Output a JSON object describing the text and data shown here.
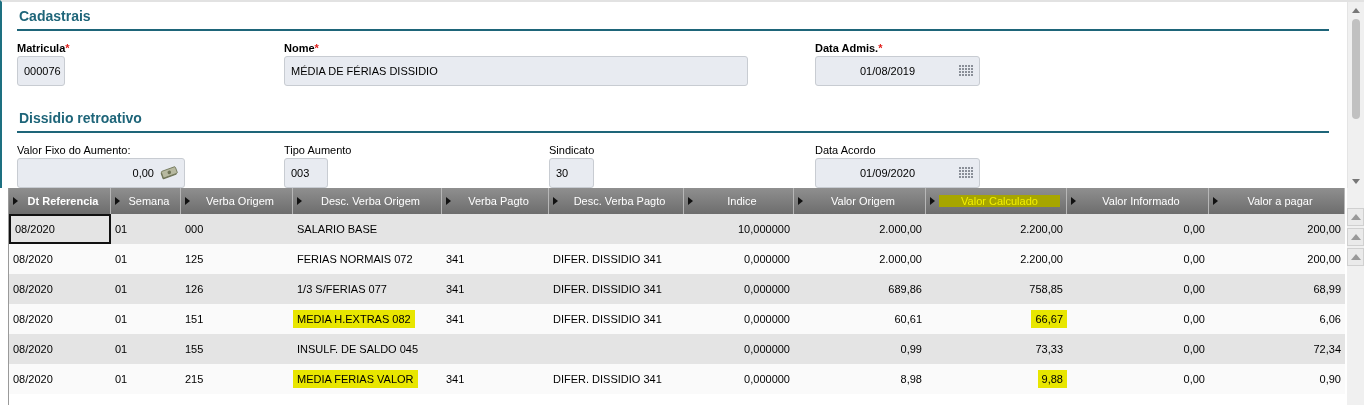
{
  "sections": [
    {
      "title": "Cadastrais",
      "kind": "bold-labels",
      "fields": [
        {
          "label": "Matricula",
          "required_mark": "*",
          "value": "000076",
          "kind": "text"
        },
        {
          "label": "Nome",
          "required_mark": "*",
          "value": "MÉDIA DE FÉRIAS DISSIDIO",
          "kind": "text"
        },
        {
          "label": "Data Admis.",
          "required_mark": "*",
          "value": "01/08/2019",
          "kind": "date"
        }
      ]
    },
    {
      "title": "Dissidio retroativo",
      "kind": "plain-labels",
      "fields": [
        {
          "label": "Valor Fixo do Aumento:",
          "value": "0,00",
          "kind": "money"
        },
        {
          "label": "Tipo Aumento",
          "value": "003",
          "kind": "text"
        },
        {
          "label": "Sindicato",
          "value": "30",
          "kind": "text"
        },
        {
          "label": "Data Acordo",
          "value": "01/09/2020",
          "kind": "date"
        }
      ]
    }
  ],
  "grid": {
    "columns": [
      {
        "label": "Dt Referencia",
        "highlighted": false
      },
      {
        "label": "Semana",
        "highlighted": false
      },
      {
        "label": "Verba Origem",
        "highlighted": false
      },
      {
        "label": "Desc. Verba Origem",
        "highlighted": false
      },
      {
        "label": "Verba Pagto",
        "highlighted": false
      },
      {
        "label": "Desc. Verba Pagto",
        "highlighted": false
      },
      {
        "label": "Indice",
        "highlighted": false
      },
      {
        "label": "Valor Origem",
        "highlighted": false
      },
      {
        "label": "Valor Calculado",
        "highlighted": true
      },
      {
        "label": "Valor Informado",
        "highlighted": false
      },
      {
        "label": "Valor a pagar",
        "highlighted": false
      }
    ],
    "rows": [
      {
        "focused": true,
        "cells": [
          {
            "text": "08/2020",
            "highlighted": false
          },
          {
            "text": "01",
            "highlighted": false
          },
          {
            "text": "000",
            "highlighted": false
          },
          {
            "text": "SALARIO BASE",
            "highlighted": false
          },
          {
            "highlighted": false
          },
          {
            "highlighted": false
          },
          {
            "text": "10,000000",
            "highlighted": false
          },
          {
            "text": "2.000,00",
            "highlighted": false
          },
          {
            "text": "2.200,00",
            "highlighted": false
          },
          {
            "text": "0,00",
            "highlighted": false
          },
          {
            "text": "200,00",
            "highlighted": false
          }
        ]
      },
      {
        "focused": false,
        "cells": [
          {
            "text": "08/2020",
            "highlighted": false
          },
          {
            "text": "01",
            "highlighted": false
          },
          {
            "text": "125",
            "highlighted": false
          },
          {
            "text": "FERIAS NORMAIS 072",
            "highlighted": false
          },
          {
            "text": "341",
            "highlighted": false
          },
          {
            "text": "DIFER. DISSIDIO 341",
            "highlighted": false
          },
          {
            "text": "0,000000",
            "highlighted": false
          },
          {
            "text": "2.000,00",
            "highlighted": false
          },
          {
            "text": "2.200,00",
            "highlighted": false
          },
          {
            "text": "0,00",
            "highlighted": false
          },
          {
            "text": "200,00",
            "highlighted": false
          }
        ]
      },
      {
        "focused": false,
        "cells": [
          {
            "text": "08/2020",
            "highlighted": false
          },
          {
            "text": "01",
            "highlighted": false
          },
          {
            "text": "126",
            "highlighted": false
          },
          {
            "text": "1/3 S/FERIAS 077",
            "highlighted": false
          },
          {
            "text": "341",
            "highlighted": false
          },
          {
            "text": "DIFER. DISSIDIO 341",
            "highlighted": false
          },
          {
            "text": "0,000000",
            "highlighted": false
          },
          {
            "text": "689,86",
            "highlighted": false
          },
          {
            "text": "758,85",
            "highlighted": false
          },
          {
            "text": "0,00",
            "highlighted": false
          },
          {
            "text": "68,99",
            "highlighted": false
          }
        ]
      },
      {
        "focused": false,
        "cells": [
          {
            "text": "08/2020",
            "highlighted": false
          },
          {
            "text": "01",
            "highlighted": false
          },
          {
            "text": "151",
            "highlighted": false
          },
          {
            "text": "MEDIA H.EXTRAS 082",
            "highlighted": true
          },
          {
            "text": "341",
            "highlighted": false
          },
          {
            "text": "DIFER. DISSIDIO 341",
            "highlighted": false
          },
          {
            "text": "0,000000",
            "highlighted": false
          },
          {
            "text": "60,61",
            "highlighted": false
          },
          {
            "text": "66,67",
            "highlighted": true
          },
          {
            "text": "0,00",
            "highlighted": false
          },
          {
            "text": "6,06",
            "highlighted": false
          }
        ]
      },
      {
        "focused": false,
        "cells": [
          {
            "text": "08/2020",
            "highlighted": false
          },
          {
            "text": "01",
            "highlighted": false
          },
          {
            "text": "155",
            "highlighted": false
          },
          {
            "text": "INSULF. DE SALDO 045",
            "highlighted": false
          },
          {
            "highlighted": false
          },
          {
            "highlighted": false
          },
          {
            "text": "0,000000",
            "highlighted": false
          },
          {
            "text": "0,99",
            "highlighted": false
          },
          {
            "text": "73,33",
            "highlighted": false
          },
          {
            "text": "0,00",
            "highlighted": false
          },
          {
            "text": "72,34",
            "highlighted": false
          }
        ]
      },
      {
        "focused": false,
        "cells": [
          {
            "text": "08/2020",
            "highlighted": false
          },
          {
            "text": "01",
            "highlighted": false
          },
          {
            "text": "215",
            "highlighted": false
          },
          {
            "text": "MEDIA FERIAS VALOR",
            "highlighted": true
          },
          {
            "text": "341",
            "highlighted": false
          },
          {
            "text": "DIFER. DISSIDIO 341",
            "highlighted": false
          },
          {
            "text": "0,000000",
            "highlighted": false
          },
          {
            "text": "8,98",
            "highlighted": false
          },
          {
            "text": "9,88",
            "highlighted": true
          },
          {
            "text": "0,00",
            "highlighted": false
          },
          {
            "text": "0,90",
            "highlighted": false
          }
        ]
      }
    ]
  }
}
